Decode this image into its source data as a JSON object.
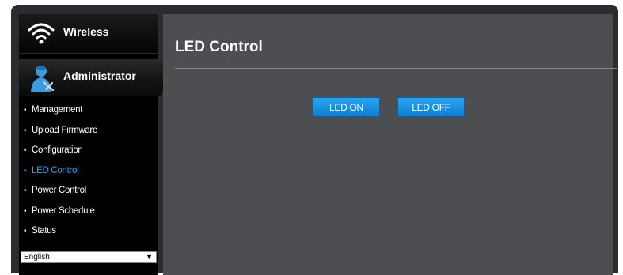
{
  "sidebar": {
    "wireless_label": "Wireless",
    "admin_label": "Administrator",
    "items": [
      {
        "label": "Management"
      },
      {
        "label": "Upload Firmware"
      },
      {
        "label": "Configuration"
      },
      {
        "label": "LED Control",
        "active": true
      },
      {
        "label": "Power Control"
      },
      {
        "label": "Power Schedule"
      },
      {
        "label": "Status"
      }
    ],
    "bullet": "•",
    "language": {
      "selected": "English"
    }
  },
  "main": {
    "title": "LED Control",
    "led_on_label": "LED ON",
    "led_off_label": "LED OFF"
  },
  "colors": {
    "active_menu": "#3aa0e8",
    "button": "#1a90e0",
    "panel": "#4d4e52"
  },
  "icons": {
    "wireless": "wifi-icon",
    "administrator": "admin-icon",
    "dropdown": "chevron-down-icon"
  }
}
